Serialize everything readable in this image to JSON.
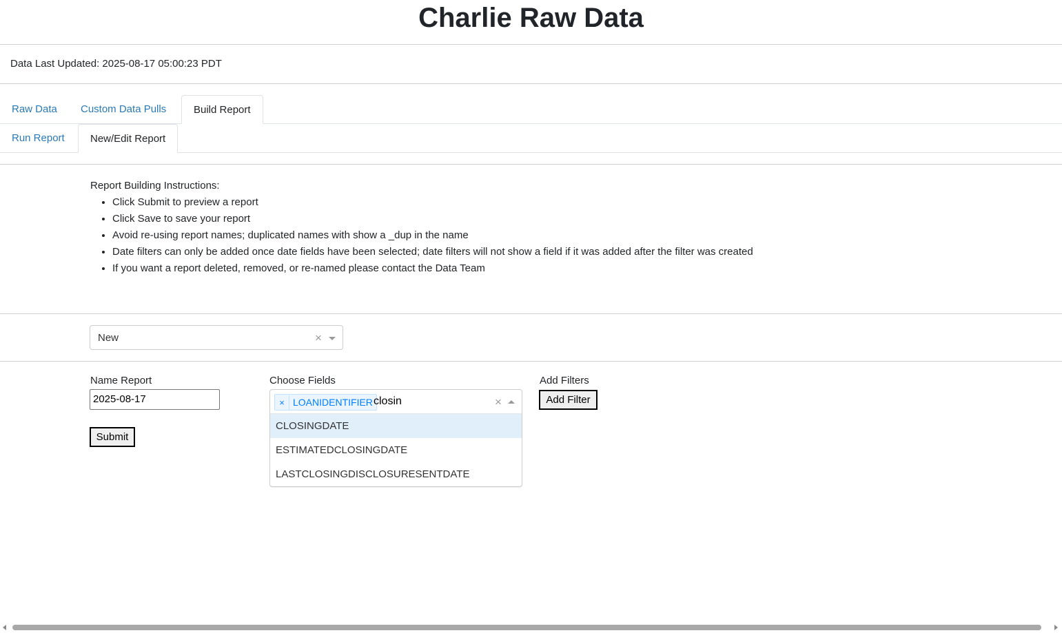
{
  "app": {
    "title": "Charlie Raw Data"
  },
  "status": {
    "last_updated": "Data Last Updated: 2025-08-17 05:00:23 PDT"
  },
  "tabs": [
    {
      "label": "Raw Data",
      "active": false
    },
    {
      "label": "Custom Data Pulls",
      "active": false
    },
    {
      "label": "Build Report",
      "active": true
    }
  ],
  "subtabs": [
    {
      "label": "Run Report",
      "active": false
    },
    {
      "label": "New/Edit Report",
      "active": true
    }
  ],
  "instructions": {
    "heading": "Report Building Instructions:",
    "items": [
      "Click Submit to preview a report",
      "Click Save to save your report",
      "Avoid re-using report names; duplicated names with show a _dup in the name",
      "Date filters can only be added once date fields have been selected; date filters will not show a field if it was added after the filter was created",
      "If you want a report deleted, removed, or re-named please contact the Data Team"
    ]
  },
  "report_select": {
    "value": "New",
    "clear_icon": "×"
  },
  "name_report": {
    "label": "Name Report",
    "value": "2025-08-17"
  },
  "submit_button": {
    "label": "Submit"
  },
  "choose_fields": {
    "label": "Choose Fields",
    "selected": [
      {
        "label": "LOANIDENTIFIER",
        "remove_icon": "×"
      }
    ],
    "search_text": "closin",
    "clear_icon": "×",
    "options": [
      {
        "label": "CLOSINGDATE",
        "focused": true
      },
      {
        "label": "ESTIMATEDCLOSINGDATE",
        "focused": false
      },
      {
        "label": "LASTCLOSINGDISCLOSURESENTDATE",
        "focused": false
      }
    ]
  },
  "filters": {
    "label": "Add Filters",
    "button_label": "Add Filter"
  }
}
